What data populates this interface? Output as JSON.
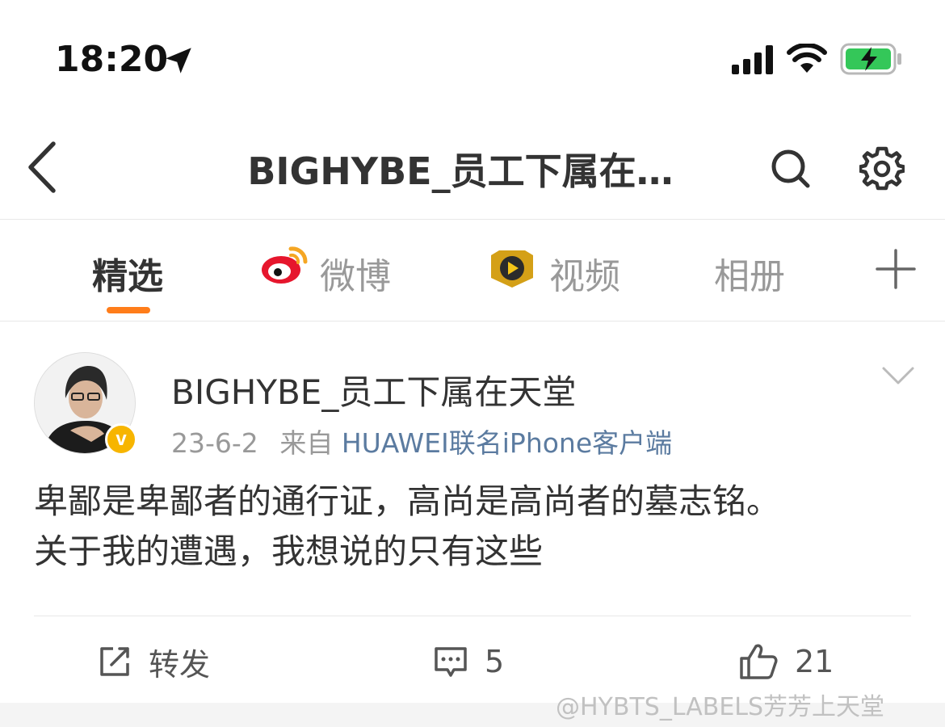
{
  "status_bar": {
    "time": "18:20",
    "icons": [
      "location-arrow-icon",
      "cellular-signal-icon",
      "wifi-icon",
      "battery-charging-icon"
    ],
    "battery_color": "#34c759"
  },
  "nav": {
    "title": "BIGHYBE_员工下属在…",
    "icons": [
      "back-icon",
      "search-icon",
      "gear-icon"
    ]
  },
  "tabs": {
    "items": [
      {
        "label": "精选",
        "active": true
      },
      {
        "label": "微博",
        "icon": "weibo-logo-icon"
      },
      {
        "label": "视频",
        "icon": "video-play-icon"
      },
      {
        "label": "相册"
      }
    ],
    "accent": "#ff7d1a",
    "more_icon": "plus-icon"
  },
  "post": {
    "username": "BIGHYBE_员工下属在天堂",
    "badge": "v",
    "date": "23-6-2",
    "from_label": "来自",
    "source": "HUAWEI联名iPhone客户端",
    "content_line1": "卑鄙是卑鄙者的通行证，高尚是高尚者的墓志铭。",
    "content_line2": "关于我的遭遇，我想说的只有这些",
    "actions": {
      "repost_label": "转发",
      "comment_count": "5",
      "like_count": "21"
    }
  },
  "watermark": "@HYBTS_LABELS芳芳上天堂"
}
